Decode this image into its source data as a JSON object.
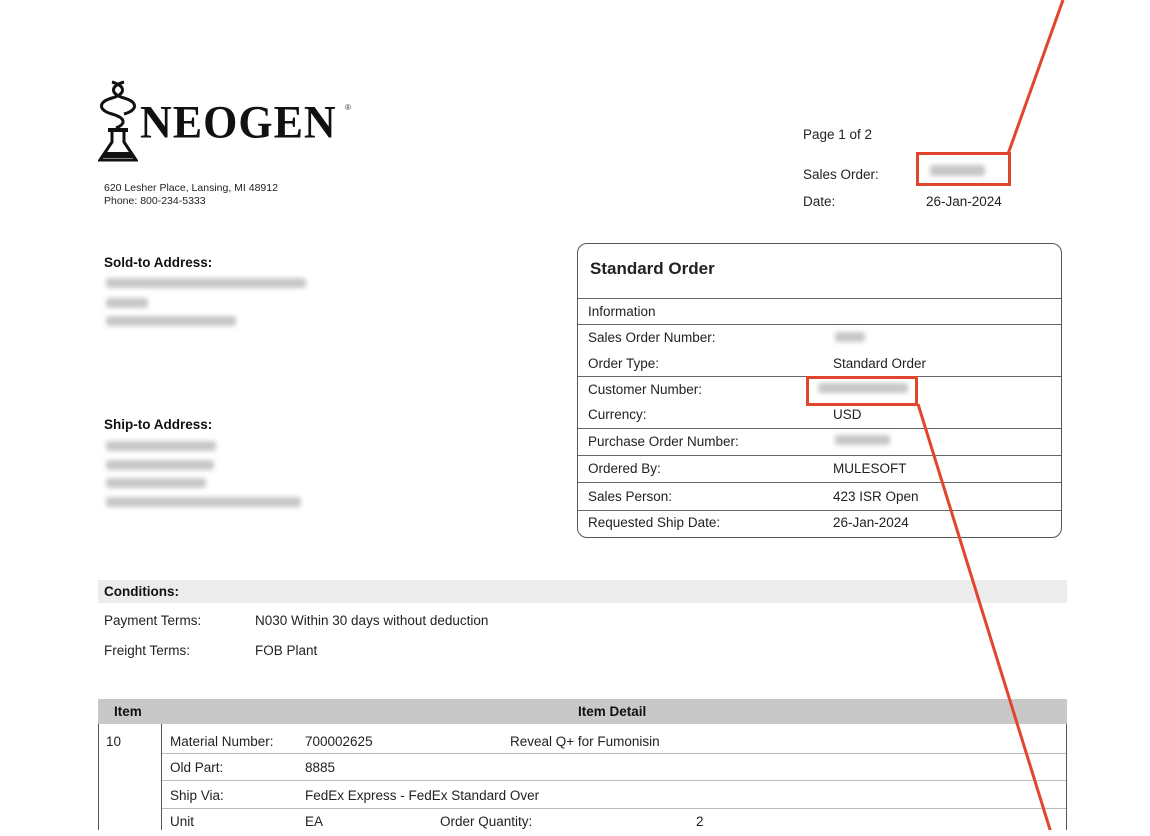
{
  "company": {
    "name": "NEOGEN",
    "reg_mark": "®",
    "address_line": "620 Lesher Place, Lansing, MI 48912",
    "phone_line": "Phone: 800-234-5333"
  },
  "page_meta": {
    "page": "Page  1 of  2",
    "sales_order_label": "Sales Order:",
    "date_label": "Date:",
    "date_value": "26-Jan-2024"
  },
  "addresses": {
    "sold_to_label": "Sold-to Address:",
    "ship_to_label": "Ship-to Address:"
  },
  "order_box": {
    "title": "Standard Order",
    "information": "Information",
    "rows": [
      {
        "label": "Sales Order Number:",
        "value": ""
      },
      {
        "label": "Order Type:",
        "value": "Standard Order"
      },
      {
        "label": "Customer Number:",
        "value": ""
      },
      {
        "label": "Currency:",
        "value": "USD"
      },
      {
        "label": "Purchase Order Number:",
        "value": ""
      },
      {
        "label": "Ordered By:",
        "value": "MULESOFT"
      },
      {
        "label": "Sales Person:",
        "value": "423 ISR Open"
      },
      {
        "label": "Requested Ship Date:",
        "value": "26-Jan-2024"
      }
    ]
  },
  "conditions": {
    "heading": "Conditions:",
    "payment_label": "Payment Terms:",
    "payment_value": "N030 Within  30 days without deduction",
    "freight_label": "Freight Terms:",
    "freight_value": "FOB Plant"
  },
  "items_table": {
    "col_item": "Item",
    "col_detail": "Item Detail",
    "item_no": "10",
    "material_label": "Material Number:",
    "material_value": "700002625",
    "description": "Reveal Q+ for Fumonisin",
    "old_part_label": "Old Part:",
    "old_part_value": "8885",
    "ship_via_label": "Ship Via:",
    "ship_via_value": "FedEx Express - FedEx Standard Over",
    "unit_label": "Unit",
    "unit_value": "EA",
    "qty_label": "Order Quantity:",
    "qty_value": "2"
  },
  "colors": {
    "annotation": "#e0462d",
    "header_fill": "#c8c8c8",
    "conditions_fill": "#ececec"
  }
}
